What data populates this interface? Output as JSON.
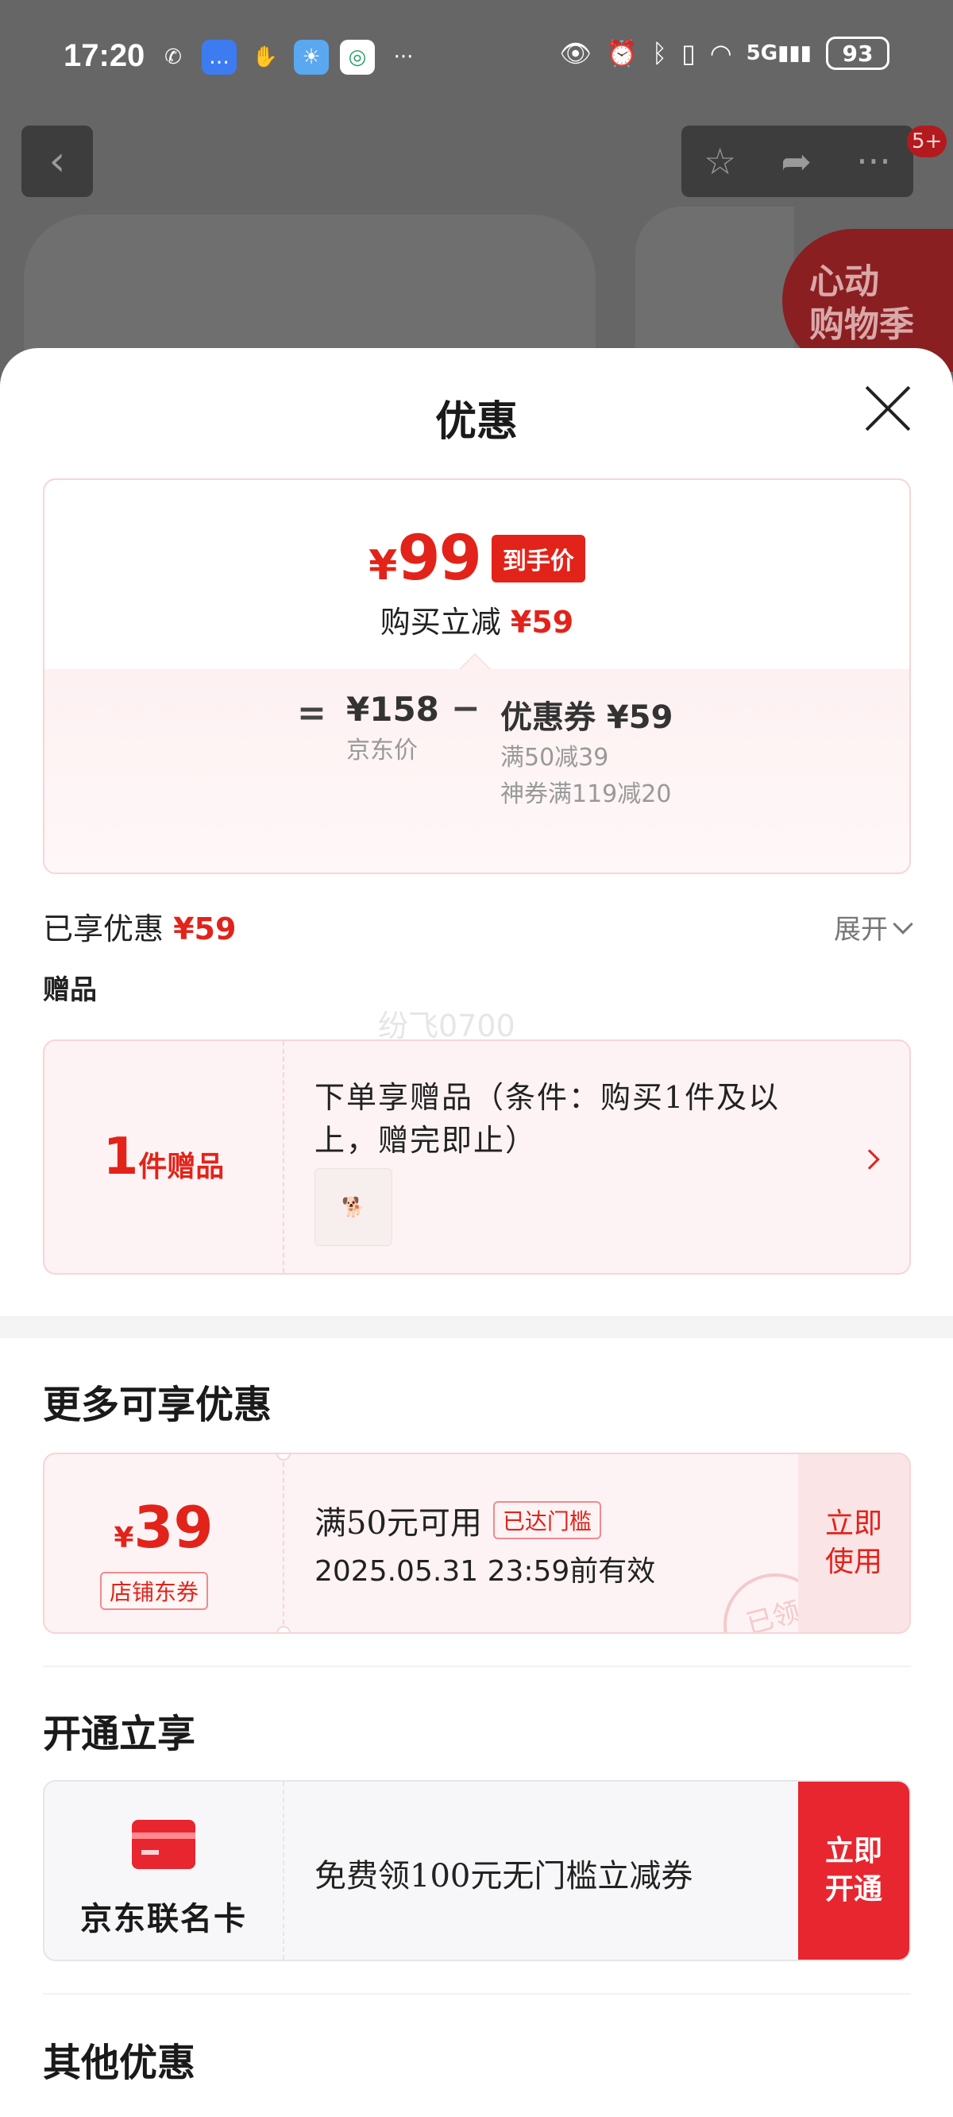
{
  "status_bar": {
    "time": "17:20",
    "battery": "93",
    "network": "5G"
  },
  "background": {
    "cart_badge": "5+",
    "promo_text": "心动\n购物季"
  },
  "sheet": {
    "title": "优惠",
    "summary": {
      "currency": "¥",
      "final_price": "99",
      "final_badge": "到手价",
      "reduce_label": "购买立减",
      "reduce_amount": "¥59",
      "eq": "=",
      "base_price": "¥158",
      "base_label": "京东价",
      "minus": "−",
      "coupon_total": "优惠券 ¥59",
      "coupon_detail_1": "满50减39",
      "coupon_detail_2": "神券满119减20"
    },
    "enjoyed_label": "已享优惠",
    "enjoyed_amount": "¥59",
    "expand_label": "展开",
    "gift_section_label": "赠品",
    "watermark": "纷飞0700",
    "gift": {
      "count": "1",
      "unit": "件赠品",
      "description": "下单享赠品（条件：购买1件及以上，赠完即止）"
    },
    "more_title": "更多可享优惠",
    "coupon": {
      "currency": "¥",
      "amount": "39",
      "tag": "店铺东券",
      "condition": "满50元可用",
      "threshold_badge": "已达门槛",
      "expiry": "2025.05.31 23:59前有效",
      "button": "立即\n使用",
      "stamp": "已领"
    },
    "open_title": "开通立享",
    "card": {
      "name": "京东联名卡",
      "description": "免费领100元无门槛立减券",
      "button": "立即\n开通"
    },
    "other_title": "其他优惠"
  },
  "colors": {
    "accent_red": "#e2231a",
    "card_red": "#e8262f",
    "pink_border": "#f6d5d6"
  }
}
